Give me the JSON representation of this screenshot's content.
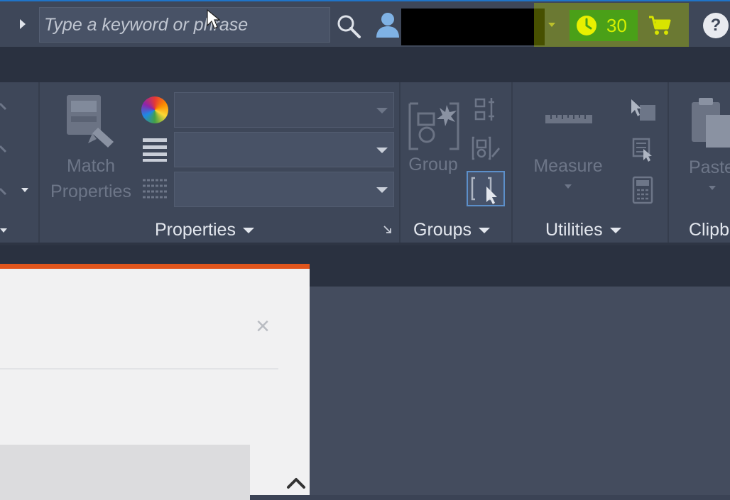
{
  "search": {
    "placeholder": "Type a keyword or phrase"
  },
  "trial": {
    "days_left": "30"
  },
  "help": {
    "label": "?"
  },
  "ribbon": {
    "match_properties": {
      "line1": "Match",
      "line2": "Properties"
    },
    "properties_panel_title": "Properties",
    "group_label": "Group",
    "groups_panel_title": "Groups",
    "measure_label": "Measure",
    "utilities_panel_title": "Utilities",
    "paste_label": "Paste",
    "clipboard_panel_title": "Clipb"
  },
  "colors": {
    "accent_blue": "#1f74c8",
    "trial_green": "#4aa018",
    "highlight_yellow": "#aabe00",
    "dialog_orange": "#e1551c"
  },
  "icons": [
    "search-icon",
    "user-icon",
    "clock-icon",
    "cart-icon",
    "help-icon",
    "match-properties-icon",
    "color-wheel-icon",
    "lineweight-icon",
    "linetype-icon",
    "group-icon",
    "measure-icon",
    "paste-icon",
    "close-icon",
    "chevron-up-icon"
  ]
}
